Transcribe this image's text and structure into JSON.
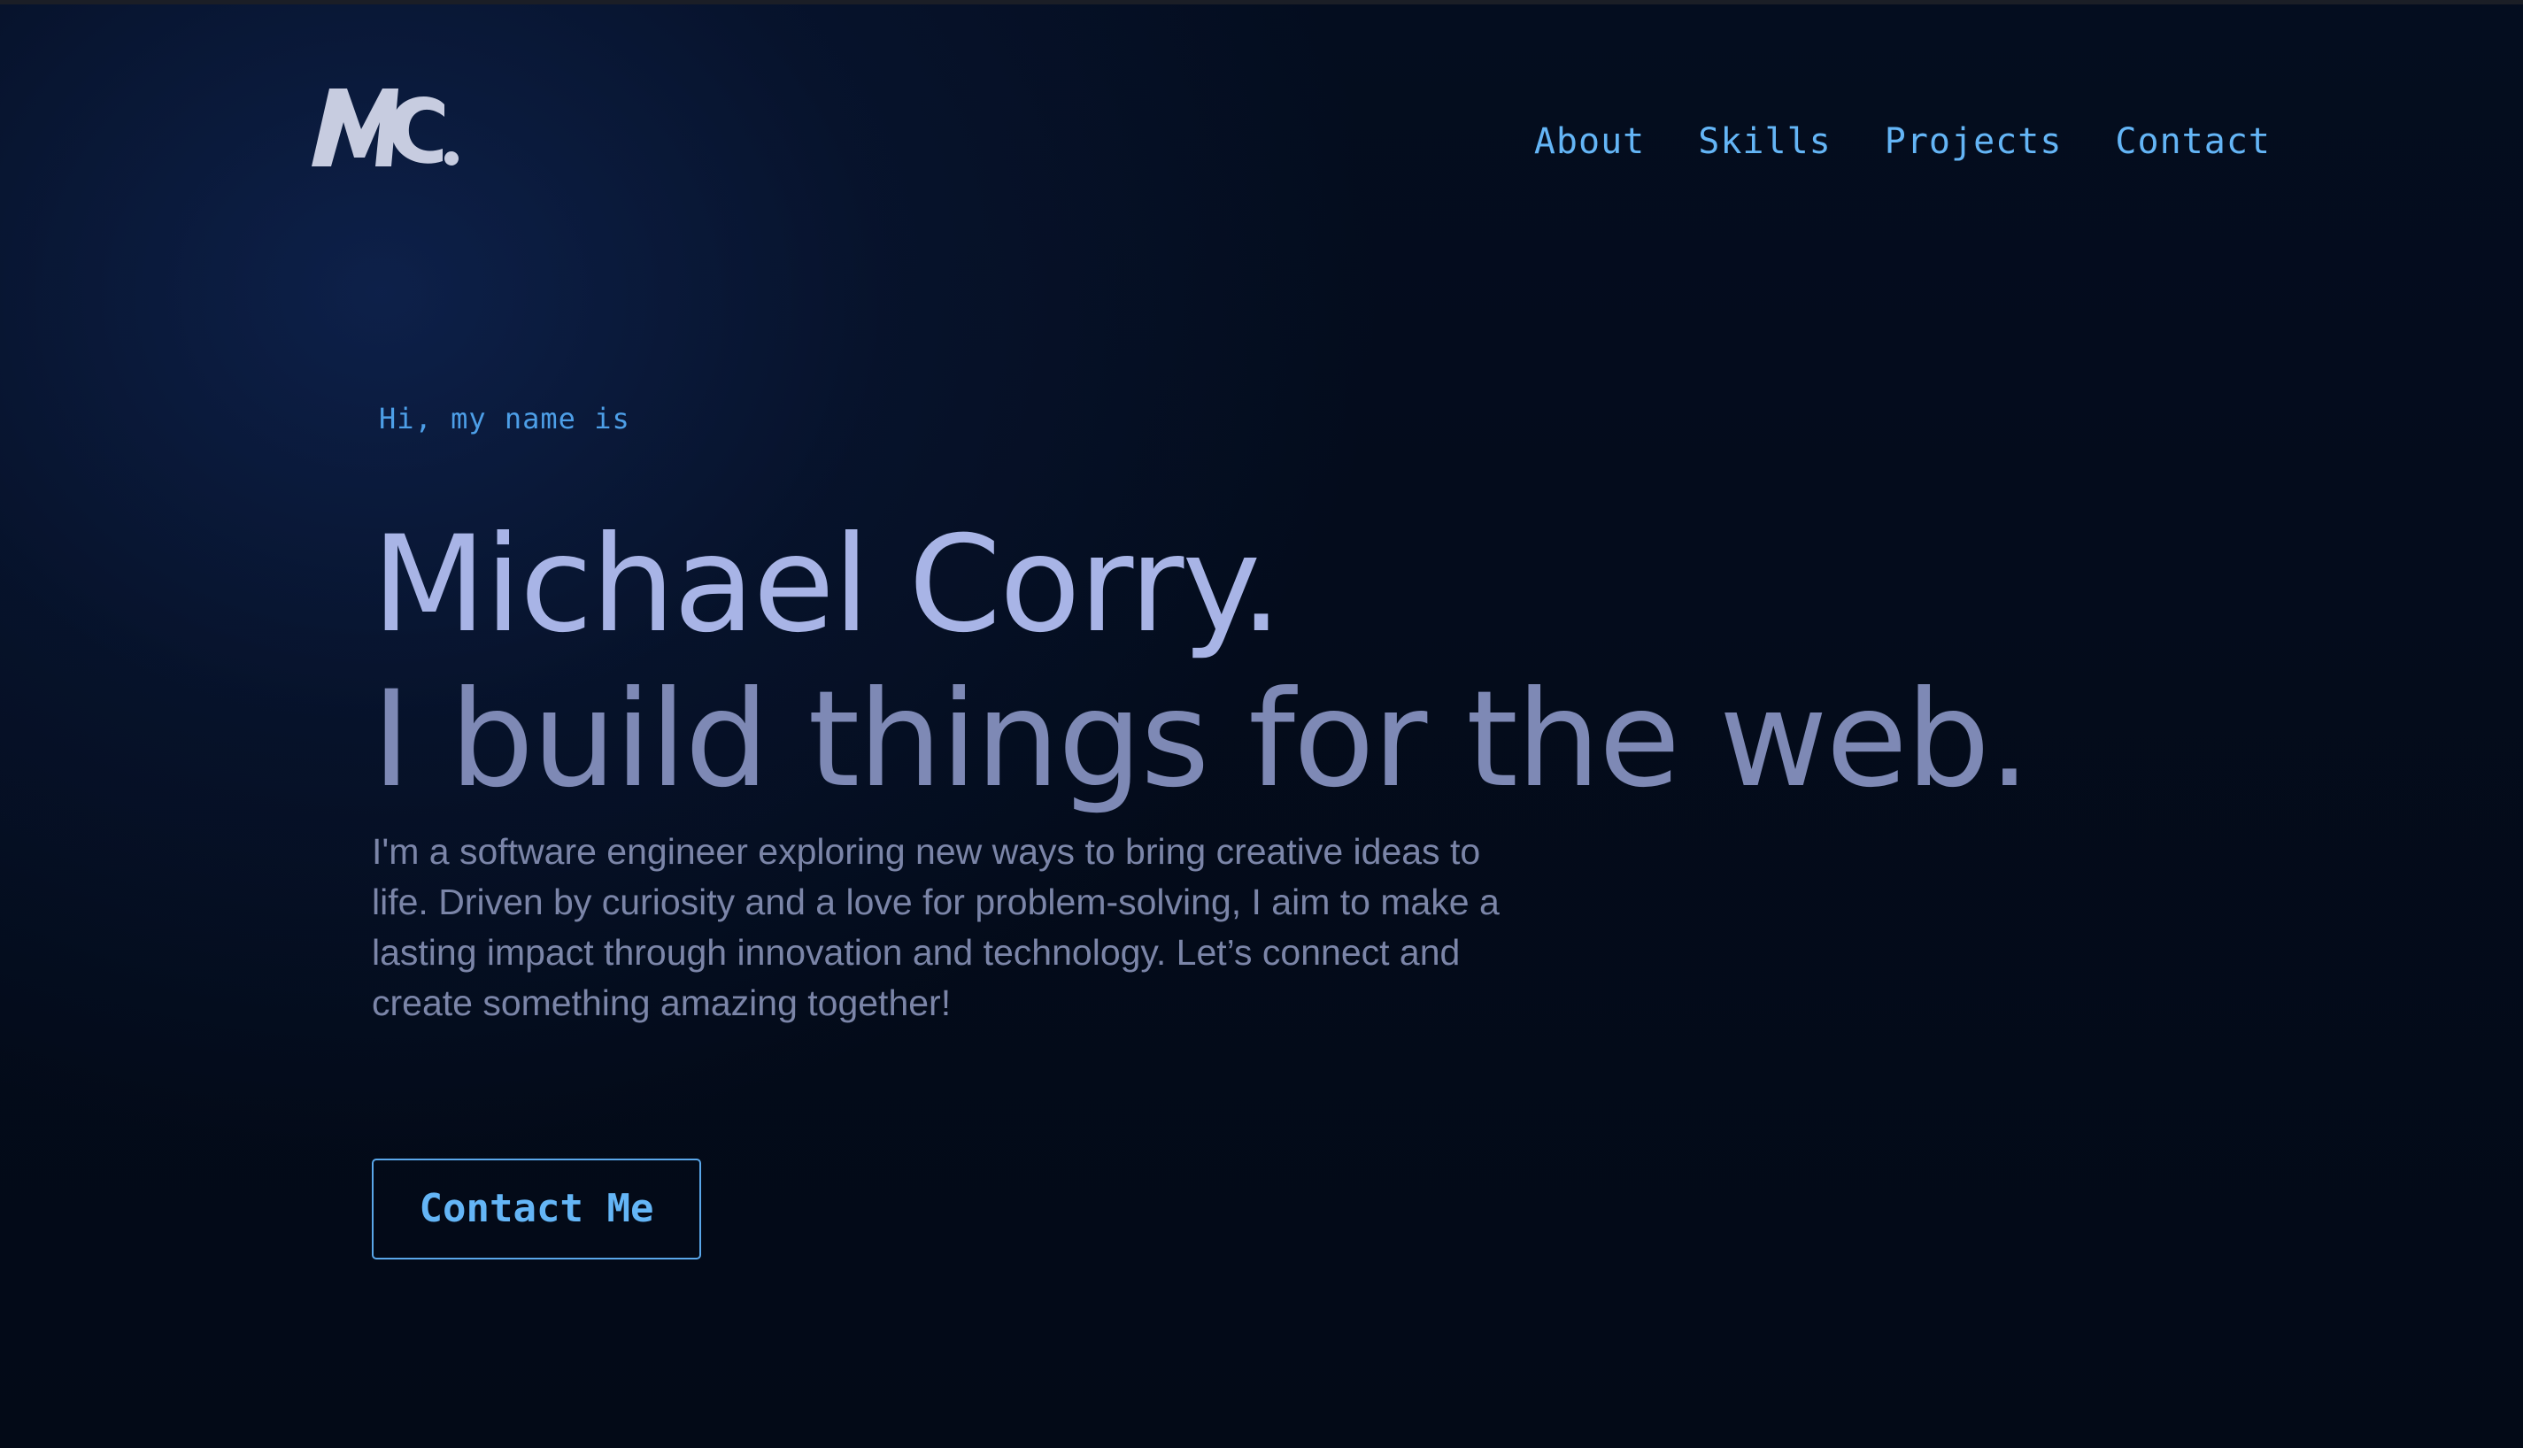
{
  "brand": {
    "logo_text": "MC."
  },
  "nav": {
    "items": [
      {
        "label": "About"
      },
      {
        "label": "Skills"
      },
      {
        "label": "Projects"
      },
      {
        "label": "Contact"
      }
    ]
  },
  "hero": {
    "greeting": "Hi, my name is",
    "name": "Michael Corry.",
    "tagline": "I build things for the web.",
    "bio": "I'm a software engineer exploring new ways to bring creative ideas to life. Driven by curiosity and a love for problem-solving, I aim to make a lasting impact through innovation and technology. Let’s connect and create something amazing together!",
    "cta_label": "Contact Me"
  },
  "colors": {
    "background": "#030a17",
    "accent": "#64b5f6",
    "name_text": "#a8b4e6",
    "tagline_text": "#7e89b5",
    "body_text": "#7b85a8",
    "logo": "#c7cce0"
  }
}
